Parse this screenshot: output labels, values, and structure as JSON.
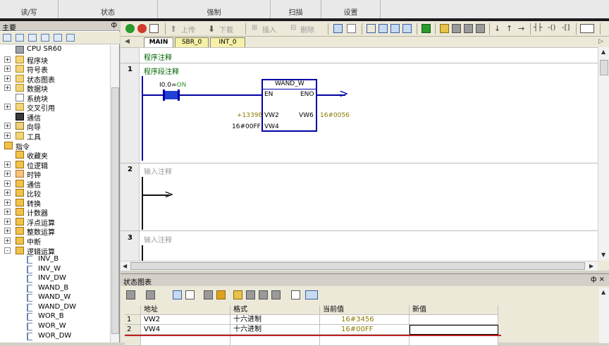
{
  "ribbon": {
    "groups": [
      "读/写",
      "状态",
      "强制",
      "扫描",
      "设置"
    ]
  },
  "left_pane": {
    "title": "主要",
    "pin": "ф",
    "tree": [
      {
        "label": "CPU SR60",
        "icon": "cpu-icon",
        "expander": ""
      },
      {
        "label": "程序块",
        "icon": "folder-icon",
        "expander": "+"
      },
      {
        "label": "符号表",
        "icon": "folder-icon",
        "expander": "+"
      },
      {
        "label": "状态图表",
        "icon": "folder-icon",
        "expander": "+"
      },
      {
        "label": "数据块",
        "icon": "folder-icon",
        "expander": "+"
      },
      {
        "label": "系统块",
        "icon": "document-icon",
        "expander": ""
      },
      {
        "label": "交叉引用",
        "icon": "folder-icon",
        "expander": "+"
      },
      {
        "label": "通信",
        "icon": "screen-icon",
        "expander": ""
      },
      {
        "label": "向导",
        "icon": "wizard-icon",
        "expander": "+"
      },
      {
        "label": "工具",
        "icon": "folder-icon",
        "expander": "+"
      },
      {
        "label": "指令",
        "icon": "instruction-icon",
        "expander": "-"
      },
      {
        "label": "收藏夹",
        "icon": "instruction-icon",
        "expander": ""
      },
      {
        "label": "位逻辑",
        "icon": "instruction-icon",
        "expander": "+"
      },
      {
        "label": "时钟",
        "icon": "clock-icon",
        "expander": "+"
      },
      {
        "label": "通信",
        "icon": "instruction-icon",
        "expander": "+"
      },
      {
        "label": "比较",
        "icon": "instruction-icon",
        "expander": "+"
      },
      {
        "label": "转换",
        "icon": "instruction-icon",
        "expander": "+"
      },
      {
        "label": "计数器",
        "icon": "instruction-icon",
        "expander": "+"
      },
      {
        "label": "浮点运算",
        "icon": "instruction-icon",
        "expander": "+"
      },
      {
        "label": "整数运算",
        "icon": "instruction-icon",
        "expander": "+"
      },
      {
        "label": "中断",
        "icon": "instruction-icon",
        "expander": "+"
      },
      {
        "label": "逻辑运算",
        "icon": "instruction-icon",
        "expander": "-"
      },
      {
        "label": "INV_B",
        "icon": "box-icon",
        "expander": ""
      },
      {
        "label": "INV_W",
        "icon": "box-icon",
        "expander": ""
      },
      {
        "label": "INV_DW",
        "icon": "box-icon",
        "expander": ""
      },
      {
        "label": "WAND_B",
        "icon": "box-icon",
        "expander": ""
      },
      {
        "label": "WAND_W",
        "icon": "box-icon",
        "expander": ""
      },
      {
        "label": "WAND_DW",
        "icon": "box-icon",
        "expander": ""
      },
      {
        "label": "WOR_B",
        "icon": "box-icon",
        "expander": ""
      },
      {
        "label": "WOR_W",
        "icon": "box-icon",
        "expander": ""
      },
      {
        "label": "WOR_DW",
        "icon": "box-icon",
        "expander": ""
      }
    ]
  },
  "toolbar": {
    "upload": "上传",
    "download": "下载",
    "insert": "插入",
    "delete": "删除"
  },
  "tabs": [
    {
      "label": "MAIN"
    },
    {
      "label": "SBR_0"
    },
    {
      "label": "INT_0"
    }
  ],
  "editor": {
    "program_comment": "程序注释",
    "networks": [
      {
        "number": "1",
        "comment": "程序段注释"
      },
      {
        "number": "2",
        "comment": "输入注释"
      },
      {
        "number": "3",
        "comment": "输入注释"
      }
    ],
    "contact": {
      "label": "I0.0=",
      "state": "ON"
    },
    "box": {
      "name": "WAND_W",
      "en": "EN",
      "eno": "ENO",
      "in1_pin": "VW2",
      "in2_pin": "VW4",
      "out_pin": "VW6",
      "in1_value": "+13398",
      "in2_value": "16#00FF",
      "out_value": "16#0056"
    }
  },
  "status_chart": {
    "title": "状态图表",
    "header_buttons": "ф ×",
    "columns": [
      "",
      "地址",
      "格式",
      "当前值",
      "新值"
    ],
    "rows": [
      {
        "n": "1",
        "address": "VW2",
        "format": "十六进制",
        "current": "16#3456",
        "new": ""
      },
      {
        "n": "2",
        "address": "VW4",
        "format": "十六进制",
        "current": "16#00FF",
        "new": ""
      }
    ]
  },
  "colors": {
    "wire": "#0000a8",
    "contact_fill": "#1f3fd6",
    "value_text": "#8a7a00",
    "comment_green": "#006400"
  }
}
